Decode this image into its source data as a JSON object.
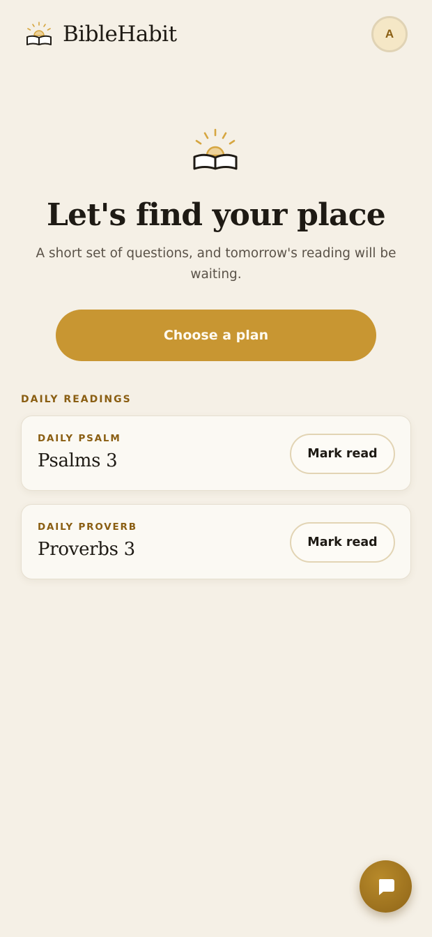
{
  "header": {
    "brand": "BibleHabit",
    "logo_icon": "sunrise-open-book-icon",
    "avatar_initial": "A"
  },
  "hero": {
    "icon": "sunrise-open-book-icon",
    "title": "Let's find your place",
    "subtitle": "A short set of questions, and tomorrow's reading will be waiting.",
    "cta_label": "Choose a plan"
  },
  "daily_readings": {
    "section_label": "DAILY READINGS",
    "items": [
      {
        "kicker": "DAILY PSALM",
        "title": "Psalms 3",
        "button_label": "Mark read"
      },
      {
        "kicker": "DAILY PROVERB",
        "title": "Proverbs 3",
        "button_label": "Mark read"
      }
    ]
  },
  "chat": {
    "icon": "chat-bubble-icon"
  },
  "colors": {
    "background": "#f5f0e6",
    "accent": "#c89632",
    "accent_dark": "#8a5e12",
    "card": "#fbf9f3",
    "text": "#1e1a14"
  }
}
